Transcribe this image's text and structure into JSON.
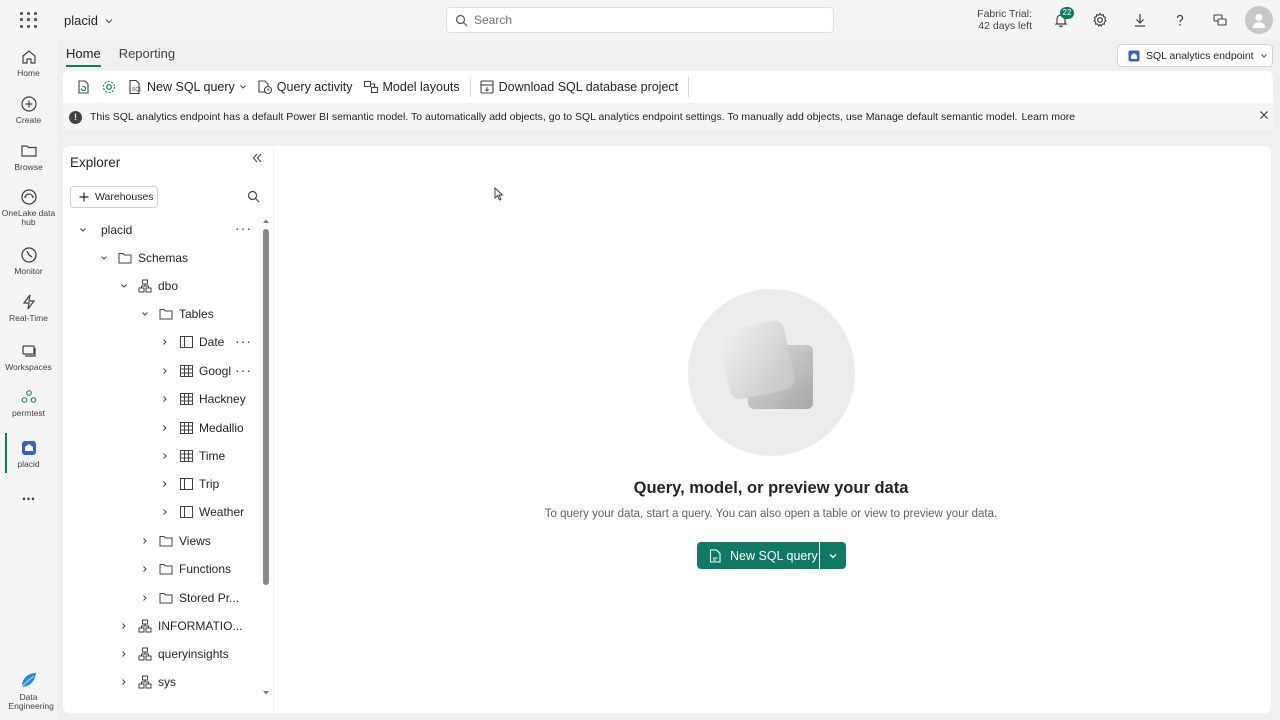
{
  "topbar": {
    "workspace": "placid",
    "search_placeholder": "Search",
    "trial_line1": "Fabric Trial:",
    "trial_line2": "42 days left",
    "notification_count": "22"
  },
  "rail": {
    "items": [
      {
        "label": "Home",
        "icon": "home-icon"
      },
      {
        "label": "Create",
        "icon": "create-icon"
      },
      {
        "label": "Browse",
        "icon": "browse-icon"
      },
      {
        "label": "OneLake data hub",
        "icon": "onelake-icon"
      },
      {
        "label": "Monitor",
        "icon": "monitor-icon"
      },
      {
        "label": "Real-Time",
        "icon": "realtime-icon"
      },
      {
        "label": "Workspaces",
        "icon": "workspaces-icon"
      },
      {
        "label": "permtest",
        "icon": "workspace-permtest-icon"
      },
      {
        "label": "placid",
        "icon": "placid-icon"
      }
    ],
    "more": "...",
    "bottom_label": "Data Engineering"
  },
  "ribbon": {
    "tabs": [
      "Home",
      "Reporting"
    ],
    "endpoint_label": "SQL analytics endpoint",
    "new_sql_query": "New SQL query",
    "query_activity": "Query activity",
    "model_layouts": "Model layouts",
    "download_project": "Download SQL database project"
  },
  "banner": {
    "text": "This SQL analytics endpoint has a default Power BI semantic model. To automatically add objects, go to SQL analytics endpoint settings. To manually add objects, use Manage default semantic model.",
    "link": "Learn more"
  },
  "explorer": {
    "title": "Explorer",
    "warehouses_button": "Warehouses",
    "tree": {
      "root": "placid",
      "schemas": "Schemas",
      "dbo": "dbo",
      "tables": "Tables",
      "table_items": [
        "Date",
        "Googl",
        "Hackney",
        "Medallio",
        "Time",
        "Trip",
        "Weather"
      ],
      "views": "Views",
      "functions": "Functions",
      "stored": "Stored Pr...",
      "information": "INFORMATIO...",
      "queryinsights": "queryinsights",
      "sys": "sys"
    }
  },
  "canvas": {
    "title": "Query, model, or preview your data",
    "subtitle": "To query your data, start a query. You can also open a table or view to preview your data.",
    "cta": "New SQL query"
  },
  "colors": {
    "accent": "#117865"
  }
}
